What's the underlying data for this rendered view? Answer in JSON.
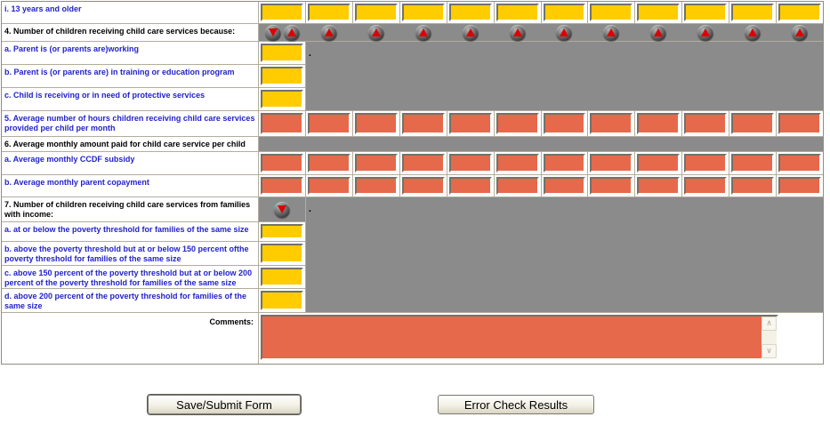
{
  "table": {
    "rows": [
      {
        "label": "i. 13 years and older",
        "color": "blue",
        "type": "row-of-12-yellow-inputs"
      },
      {
        "label": "4. Number of children receiving child care services because:",
        "color": "black",
        "type": "icon-strip"
      },
      {
        "label": "a. Parent is (or parents are)working",
        "color": "blue",
        "type": "single-yellow-input"
      },
      {
        "label": "b. Parent is (or parents are) in training or education program",
        "color": "blue",
        "type": "single-yellow-input"
      },
      {
        "label": "c. Child is receiving or in need of protective services",
        "color": "blue",
        "type": "single-yellow-input"
      },
      {
        "label": "5. Average number of hours children receiving child care services provided per child per month",
        "color": "blue",
        "type": "row-of-12-red-inputs"
      },
      {
        "label": "6. Average monthly amount paid for child care service per child",
        "color": "black",
        "type": "gray-bar"
      },
      {
        "label": "a. Average monthly CCDF subsidy",
        "color": "blue",
        "type": "row-of-12-red-inputs"
      },
      {
        "label": "b. Average monthly parent copayment",
        "color": "blue",
        "type": "row-of-12-red-inputs"
      },
      {
        "label": "7. Number of children receiving child care services from families with income:",
        "color": "black",
        "type": "down-arrow-cell"
      },
      {
        "label": "a. at or below the poverty threshold for families of the same size",
        "color": "blue",
        "type": "single-yellow-input"
      },
      {
        "label": "b. above the poverty threshold but at or below 150 percent ofthe poverty threshold for families of the same size",
        "color": "blue",
        "type": "single-yellow-input"
      },
      {
        "label": "c. above 150 percent of the poverty threshold but at or below 200 percent of the poverty threshold for families of the same size",
        "color": "blue",
        "type": "single-yellow-input"
      },
      {
        "label": "d. above 200 percent of the poverty threshold for families of the same size",
        "color": "blue",
        "type": "single-yellow-input"
      }
    ],
    "period_text": ".",
    "input_value": "",
    "columns_count": 12,
    "comments": {
      "label": "Comments:",
      "value": ""
    }
  },
  "icons": {
    "row4": [
      "arrow-down",
      "arrow-up",
      "arrow-up",
      "arrow-up",
      "arrow-up",
      "arrow-up",
      "arrow-up",
      "arrow-up",
      "arrow-up",
      "arrow-up",
      "arrow-up",
      "arrow-up",
      "arrow-up"
    ],
    "row7": "arrow-down",
    "scrollbar": [
      "chevron-up",
      "chevron-down"
    ],
    "scrollbar_up_glyph": "∧",
    "scrollbar_down_glyph": "∨"
  },
  "buttons": {
    "save": {
      "label": "Save/Submit Form"
    },
    "error": {
      "label": "Error Check Results"
    }
  },
  "colors": {
    "yellow_input": "#ffcc00",
    "red_input": "#e6694c",
    "gray_panel": "#8b8b8b",
    "arrow_red": "#dd0000",
    "label_blue": "#2222cc",
    "label_black": "#000000"
  }
}
